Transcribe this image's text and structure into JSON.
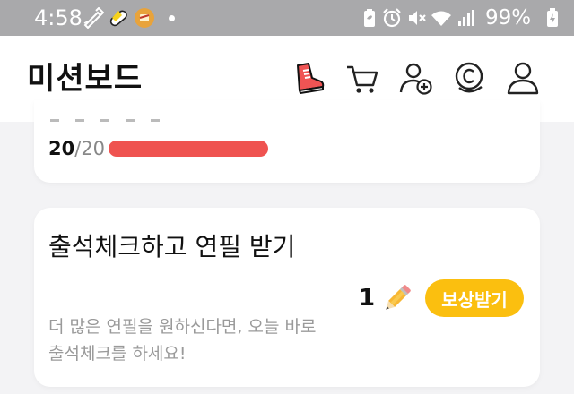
{
  "status_bar": {
    "time": "4:58",
    "battery": "99%",
    "icons": [
      "sketch-pen-icon",
      "capsule-icon",
      "app-badge-icon",
      "notification-dot",
      "battery-saver-icon",
      "alarm-icon",
      "mute-icon",
      "wifi-icon",
      "signal-icon",
      "charging-battery-icon"
    ]
  },
  "header": {
    "title": "미션보드",
    "icons": [
      "sneaker-icon",
      "cart-icon",
      "add-friend-icon",
      "coin-icon",
      "profile-icon"
    ]
  },
  "progress_card": {
    "current": "20",
    "separator": "/",
    "total": "20",
    "progress": 1.0,
    "bar_color": "#ef5350"
  },
  "attendance_card": {
    "title": "출석체크하고 연필 받기",
    "description": "더 많은 연필을 원하신다면, 오늘 바로 출석체크를 하세요!",
    "reward_count": "1",
    "reward_icon": "pencil-icon",
    "button_label": "보상받기",
    "button_color": "#fbbf0f"
  }
}
